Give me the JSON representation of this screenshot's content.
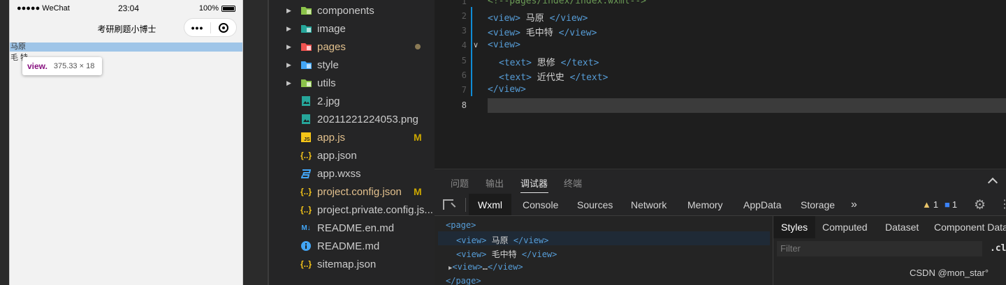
{
  "simulator": {
    "carrier": "●●●●● WeChat",
    "wifi_icon": "wifi-icon",
    "time": "23:04",
    "battery": "100%",
    "nav_title": "考研刷题小博士",
    "capsule_dots": "•••",
    "content_line1": "马原",
    "content_line2": "毛 特",
    "tooltip": {
      "tag": "view.",
      "size": "375.33 × 18"
    }
  },
  "explorer": {
    "items": [
      {
        "name": "components",
        "type": "folder",
        "icon": "folder-components-icon",
        "icon_color": "#8bc34a",
        "badge": ""
      },
      {
        "name": "image",
        "type": "folder",
        "icon": "folder-image-icon",
        "icon_color": "#26a69a",
        "badge": ""
      },
      {
        "name": "pages",
        "type": "folder",
        "icon": "folder-pages-icon",
        "icon_color": "#ef5350",
        "badge": "",
        "modified_dot": true
      },
      {
        "name": "style",
        "type": "folder",
        "icon": "folder-style-icon",
        "icon_color": "#42a5f5",
        "badge": ""
      },
      {
        "name": "utils",
        "type": "folder",
        "icon": "folder-utils-icon",
        "icon_color": "#8bc34a",
        "badge": ""
      },
      {
        "name": "2.jpg",
        "type": "file",
        "icon": "image-file-icon",
        "icon_color": "#26a69a",
        "badge": ""
      },
      {
        "name": "20211221224053.png",
        "type": "file",
        "icon": "image-file-icon",
        "icon_color": "#26a69a",
        "badge": ""
      },
      {
        "name": "app.js",
        "type": "file",
        "icon": "js-file-icon",
        "icon_color": "#f5c518",
        "badge": "M"
      },
      {
        "name": "app.json",
        "type": "file",
        "icon": "json-file-icon",
        "icon_color": "#f5c518",
        "badge": ""
      },
      {
        "name": "app.wxss",
        "type": "file",
        "icon": "css-file-icon",
        "icon_color": "#42a5f5",
        "badge": ""
      },
      {
        "name": "project.config.json",
        "type": "file",
        "icon": "json-file-icon",
        "icon_color": "#f5c518",
        "badge": "M"
      },
      {
        "name": "project.private.config.js...",
        "type": "file",
        "icon": "json-file-icon",
        "icon_color": "#f5c518",
        "badge": ""
      },
      {
        "name": "README.en.md",
        "type": "file",
        "icon": "markdown-file-icon",
        "icon_color": "#42a5f5",
        "badge": ""
      },
      {
        "name": "README.md",
        "type": "file",
        "icon": "info-file-icon",
        "icon_color": "#42a5f5",
        "badge": ""
      },
      {
        "name": "sitemap.json",
        "type": "file",
        "icon": "json-file-icon",
        "icon_color": "#f5c518",
        "badge": ""
      }
    ]
  },
  "editor": {
    "line_numbers": [
      "1",
      "2",
      "3",
      "4",
      "5",
      "6",
      "7",
      "8"
    ],
    "comment": "<!--pages/index/index.wxml-->",
    "line2": {
      "open": "<view>",
      "text": " 马原 ",
      "close": "</view>"
    },
    "line3": {
      "open": "<view>",
      "text": " 毛中特 ",
      "close": "</view>"
    },
    "line4": {
      "open": "<view>"
    },
    "line5": {
      "open": "<text>",
      "text": " 思修 ",
      "close": "</text>"
    },
    "line6": {
      "open": "<text>",
      "text": " 近代史 ",
      "close": "</text>"
    },
    "line7": {
      "close": "</view>"
    }
  },
  "panel": {
    "tabs": [
      "问题",
      "输出",
      "调试器",
      "终端"
    ],
    "devtools_tabs": [
      "Wxml",
      "Console",
      "Sources",
      "Network",
      "Memory",
      "AppData",
      "Storage",
      "»"
    ],
    "warnings": "1",
    "infos": "1",
    "dom": {
      "page_open": "<page>",
      "view1": {
        "open": "<view>",
        "text": " 马原 ",
        "close": "</view>"
      },
      "view2": {
        "open": "<view>",
        "text": " 毛中特 ",
        "close": "</view>"
      },
      "view3": {
        "open": "<view>",
        "ellipsis": "…",
        "close": "</view>"
      },
      "page_close": "</page>"
    },
    "style_tabs": [
      "Styles",
      "Computed",
      "Dataset",
      "Component Data"
    ],
    "filter_placeholder": "Filter",
    "cls_button": ".cls"
  },
  "watermark": "CSDN @mon_star°",
  "colors": {
    "tag_blue": "#569cd6",
    "comment_green": "#6a9955",
    "modified_yellow": "#cca700",
    "highlight_blue": "#9fc5e8"
  }
}
